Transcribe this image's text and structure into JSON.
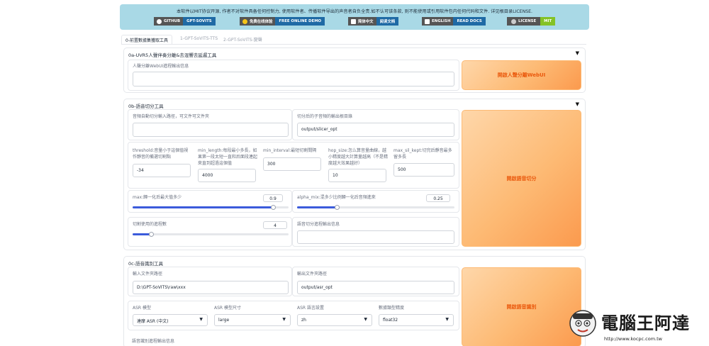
{
  "banner": {
    "text": "本软件以MIT协议开源, 作者不对软件具备任何控制力, 使用软件者、传播软件导出的声音者自负全责.如不认可该条款, 则不能使用或引用软件包内任何代码和文件. 详见根目录LICENSE.",
    "badges": [
      {
        "left": "GITHUB",
        "right": "GPT-SOVITS",
        "color": "#1f6aa5",
        "icon": "github-icon"
      },
      {
        "left": "免费在线体验",
        "right": "FREE ONLINE DEMO",
        "color": "#1f6aa5",
        "icon": "face-icon"
      },
      {
        "left": "简体中文",
        "right": "阅读文档",
        "color": "#1f6aa5",
        "icon": "doc-icon"
      },
      {
        "left": "ENGLISH",
        "right": "READ DOCS",
        "color": "#1f6aa5",
        "icon": "doc-icon"
      },
      {
        "left": "LICENSE",
        "right": "MIT",
        "color": "#84c225",
        "icon": "license-icon"
      }
    ]
  },
  "tabs": [
    "0-前置數據集獲取工具",
    "1-GPT-SoVITS-TTS",
    "2-GPT-SoVITS-變聲"
  ],
  "uvr": {
    "title": "0a-UVR5人聲伴奏分離&去混響去延遲工具",
    "output_label": "人聲分離WebUI進程輸出信息",
    "output_value": "",
    "button": "開啟人聲分離WebUI"
  },
  "slicer": {
    "title": "0b-語音切分工具",
    "input_label": "音頻自動切分輸入路徑，可文件可文件夾",
    "input_value": "",
    "output_label": "切分后的子音頻的輸出根目錄",
    "output_value": "output/slicer_opt",
    "params": [
      {
        "label": "threshold:音量小于這個值視作靜音的備選切割點",
        "value": "-34"
      },
      {
        "label": "min_length:每段最小多長，如果第一段太短一直和后面段連起來直到超過這個值",
        "value": "4000"
      },
      {
        "label": "min_interval:最短切割間隔",
        "value": "300"
      },
      {
        "label": "hop_size:怎么算音量曲線，越小精度越大計算量越高（不是精度越大效果越好）",
        "value": "10"
      },
      {
        "label": "max_sil_kept:切完后靜音最多留多長",
        "value": "500"
      }
    ],
    "max_label": "max:歸一化后最大值多少",
    "max_value": "0.9",
    "max_fraction": 0.9,
    "alpha_label": "alpha_mix:混多少比例歸一化后音頻進來",
    "alpha_value": "0.25",
    "alpha_fraction": 0.25,
    "proc_label": "切割使用的進程數",
    "proc_value": "4",
    "proc_fraction": 0.12,
    "out_info_label": "語音切分進程輸出信息",
    "button": "開啟語音切分"
  },
  "asr": {
    "title": "0c-語音識別工具",
    "input_label": "輸入文件夾路徑",
    "input_value": "D:\\GPT-SoVITS\\raw\\xxx",
    "output_label": "輸出文件夾路徑",
    "output_value": "output/asr_opt",
    "model_label": "ASR 模型",
    "model_value": "達摩 ASR (中文)",
    "size_label": "ASR 模型尺寸",
    "size_value": "large",
    "lang_label": "ASR 語言設置",
    "lang_value": "zh",
    "dtype_label": "數據類型精度",
    "dtype_value": "float32",
    "out_info_label": "語音識別進程輸出信息",
    "button": "開啟語音識別"
  },
  "watermark": {
    "title": "電腦王阿達",
    "url": "http://www.kocpc.com.tw"
  }
}
